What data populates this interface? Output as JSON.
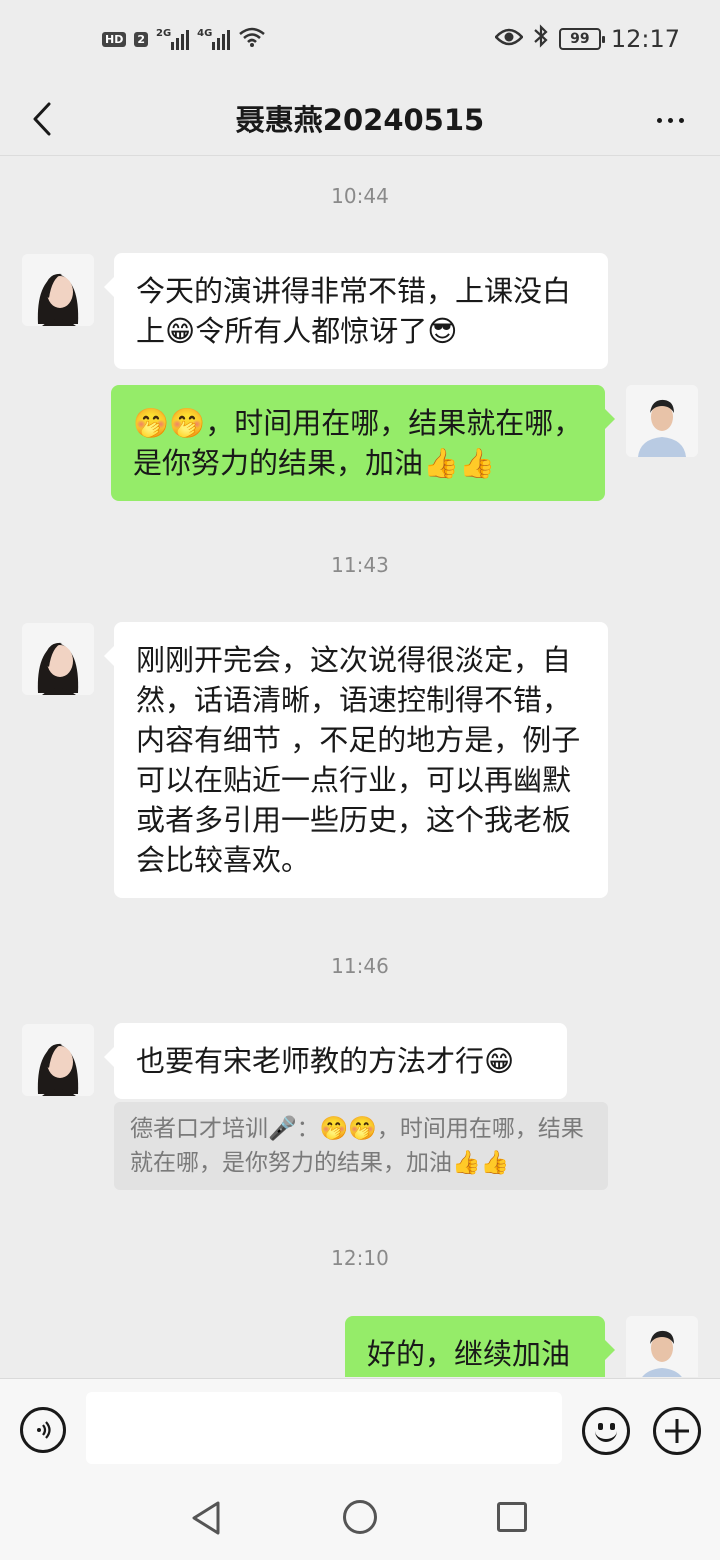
{
  "status_bar": {
    "hd_label": "HD",
    "sim_label": "2",
    "net_2g": "2G",
    "net_4g": "4G",
    "battery": "99",
    "time": "12:17"
  },
  "header": {
    "title": "聂惠燕20240515"
  },
  "messages": [
    {
      "time": "10:44"
    },
    {
      "text": "今天的演讲得非常不错，上课没白上😁令所有人都惊讶了😎"
    },
    {
      "text": "🤭🤭，时间用在哪，结果就在哪，是你努力的结果，加油👍👍"
    },
    {
      "time": "11:43"
    },
    {
      "text": "刚刚开完会，这次说得很淡定，自然，话语清晰，语速控制得不错，内容有细节 ，不足的地方是，例子可以在贴近一点行业，可以再幽默或者多引用一些历史，这个我老板会比较喜欢。"
    },
    {
      "time": "11:46"
    },
    {
      "text": "也要有宋老师教的方法才行😁"
    },
    {
      "quote": "德者口才培训🎤：🤭🤭，时间用在哪，结果就在哪，是你努力的结果，加油👍👍"
    },
    {
      "time": "12:10"
    },
    {
      "text": "好的，继续加油"
    }
  ],
  "icons": {
    "back": "chevron-left-icon",
    "more": "ellipsis-icon",
    "voice": "voice-icon",
    "emoji": "emoji-icon",
    "plus": "plus-icon"
  },
  "colors": {
    "background": "#ededed",
    "bubble_self": "#95ec69",
    "bubble_other": "#ffffff"
  }
}
